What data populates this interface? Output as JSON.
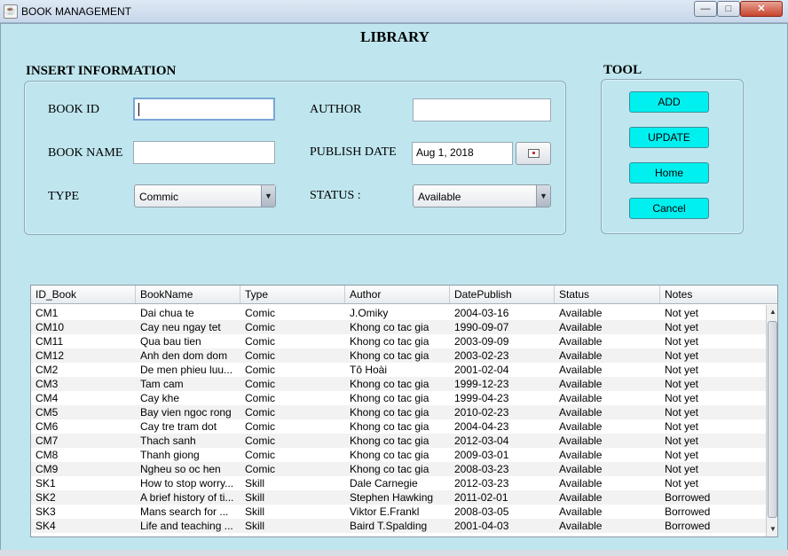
{
  "window": {
    "title": "BOOK MANAGEMENT",
    "icon_glyph": "☕",
    "minimize_glyph": "—",
    "maximize_glyph": "□",
    "close_glyph": "✕"
  },
  "app_title": "LIBRARY",
  "insert_section": {
    "title": "INSERT INFORMATION",
    "book_id_label": "BOOK ID",
    "book_id_value": "",
    "book_name_label": "BOOK NAME",
    "book_name_value": "",
    "type_label": "TYPE",
    "type_value": "Commic",
    "author_label": "AUTHOR",
    "author_value": "",
    "publish_date_label": "PUBLISH DATE",
    "publish_date_value": "Aug 1, 2018",
    "status_label": "STATUS :",
    "status_value": "Available",
    "dropdown_glyph": "▼"
  },
  "tool_section": {
    "title": "TOOL",
    "add_label": "ADD",
    "update_label": "UPDATE",
    "home_label": "Home",
    "cancel_label": "Cancel"
  },
  "table": {
    "columns": [
      "ID_Book",
      "BookName",
      "Type",
      "Author",
      "DatePublish",
      "Status",
      "Notes"
    ],
    "rows": [
      [
        "CM1",
        "Dai chua te",
        "Comic",
        "J.Omiky",
        "2004-03-16",
        "Available",
        "Not yet"
      ],
      [
        "CM10",
        "Cay neu ngay tet",
        "Comic",
        "Khong co tac gia",
        "1990-09-07",
        "Available",
        "Not yet"
      ],
      [
        "CM11",
        "Qua bau tien",
        "Comic",
        "Khong co tac gia",
        "2003-09-09",
        "Available",
        "Not yet"
      ],
      [
        "CM12",
        "Anh den dom dom",
        "Comic",
        "Khong co tac gia",
        "2003-02-23",
        "Available",
        " Not yet"
      ],
      [
        "CM2",
        "De men phieu luu...",
        "Comic",
        "Tô Hoài",
        "2001-02-04",
        "Available",
        "Not yet"
      ],
      [
        "CM3",
        "Tam cam",
        "Comic",
        "Khong co tac gia",
        "1999-12-23",
        "Available",
        "Not yet"
      ],
      [
        "CM4",
        "Cay khe",
        "Comic",
        "Khong co tac gia",
        "1999-04-23",
        "Available",
        "Not yet"
      ],
      [
        "CM5",
        "Bay vien ngoc rong",
        "Comic",
        "Khong co tac gia",
        "2010-02-23",
        "Available",
        "Not yet"
      ],
      [
        "CM6",
        "Cay tre tram dot",
        "Comic",
        "Khong co tac gia",
        "2004-04-23",
        "Available",
        "Not yet"
      ],
      [
        "CM7",
        "Thach sanh",
        "Comic",
        "Khong co tac gia",
        "2012-03-04",
        "Available",
        "Not yet"
      ],
      [
        "CM8",
        "Thanh giong",
        "Comic",
        "Khong co tac gia",
        "2009-03-01",
        "Available",
        "Not yet"
      ],
      [
        "CM9",
        "Ngheu so oc hen",
        "Comic",
        "Khong co tac gia",
        "2008-03-23",
        "Available",
        "Not yet"
      ],
      [
        "SK1",
        "How to stop worry...",
        "Skill",
        "Dale Carnegie",
        "2012-03-23",
        "Available",
        "Not yet"
      ],
      [
        "SK2",
        "A brief history of ti...",
        "Skill",
        "Stephen Hawking",
        "2011-02-01",
        "Available",
        "Borrowed"
      ],
      [
        "SK3",
        "Mans search for ...",
        "Skill",
        "Viktor E.Frankl",
        "2008-03-05",
        "Available",
        "Borrowed"
      ],
      [
        "SK4",
        "Life and teaching ...",
        "Skill",
        "Baird T.Spalding",
        "2001-04-03",
        "Available",
        "Borrowed"
      ]
    ],
    "scroll_up_glyph": "▲",
    "scroll_down_glyph": "▼"
  },
  "colors": {
    "background": "#bfe6ee",
    "tool_button": "#00f0f0"
  }
}
